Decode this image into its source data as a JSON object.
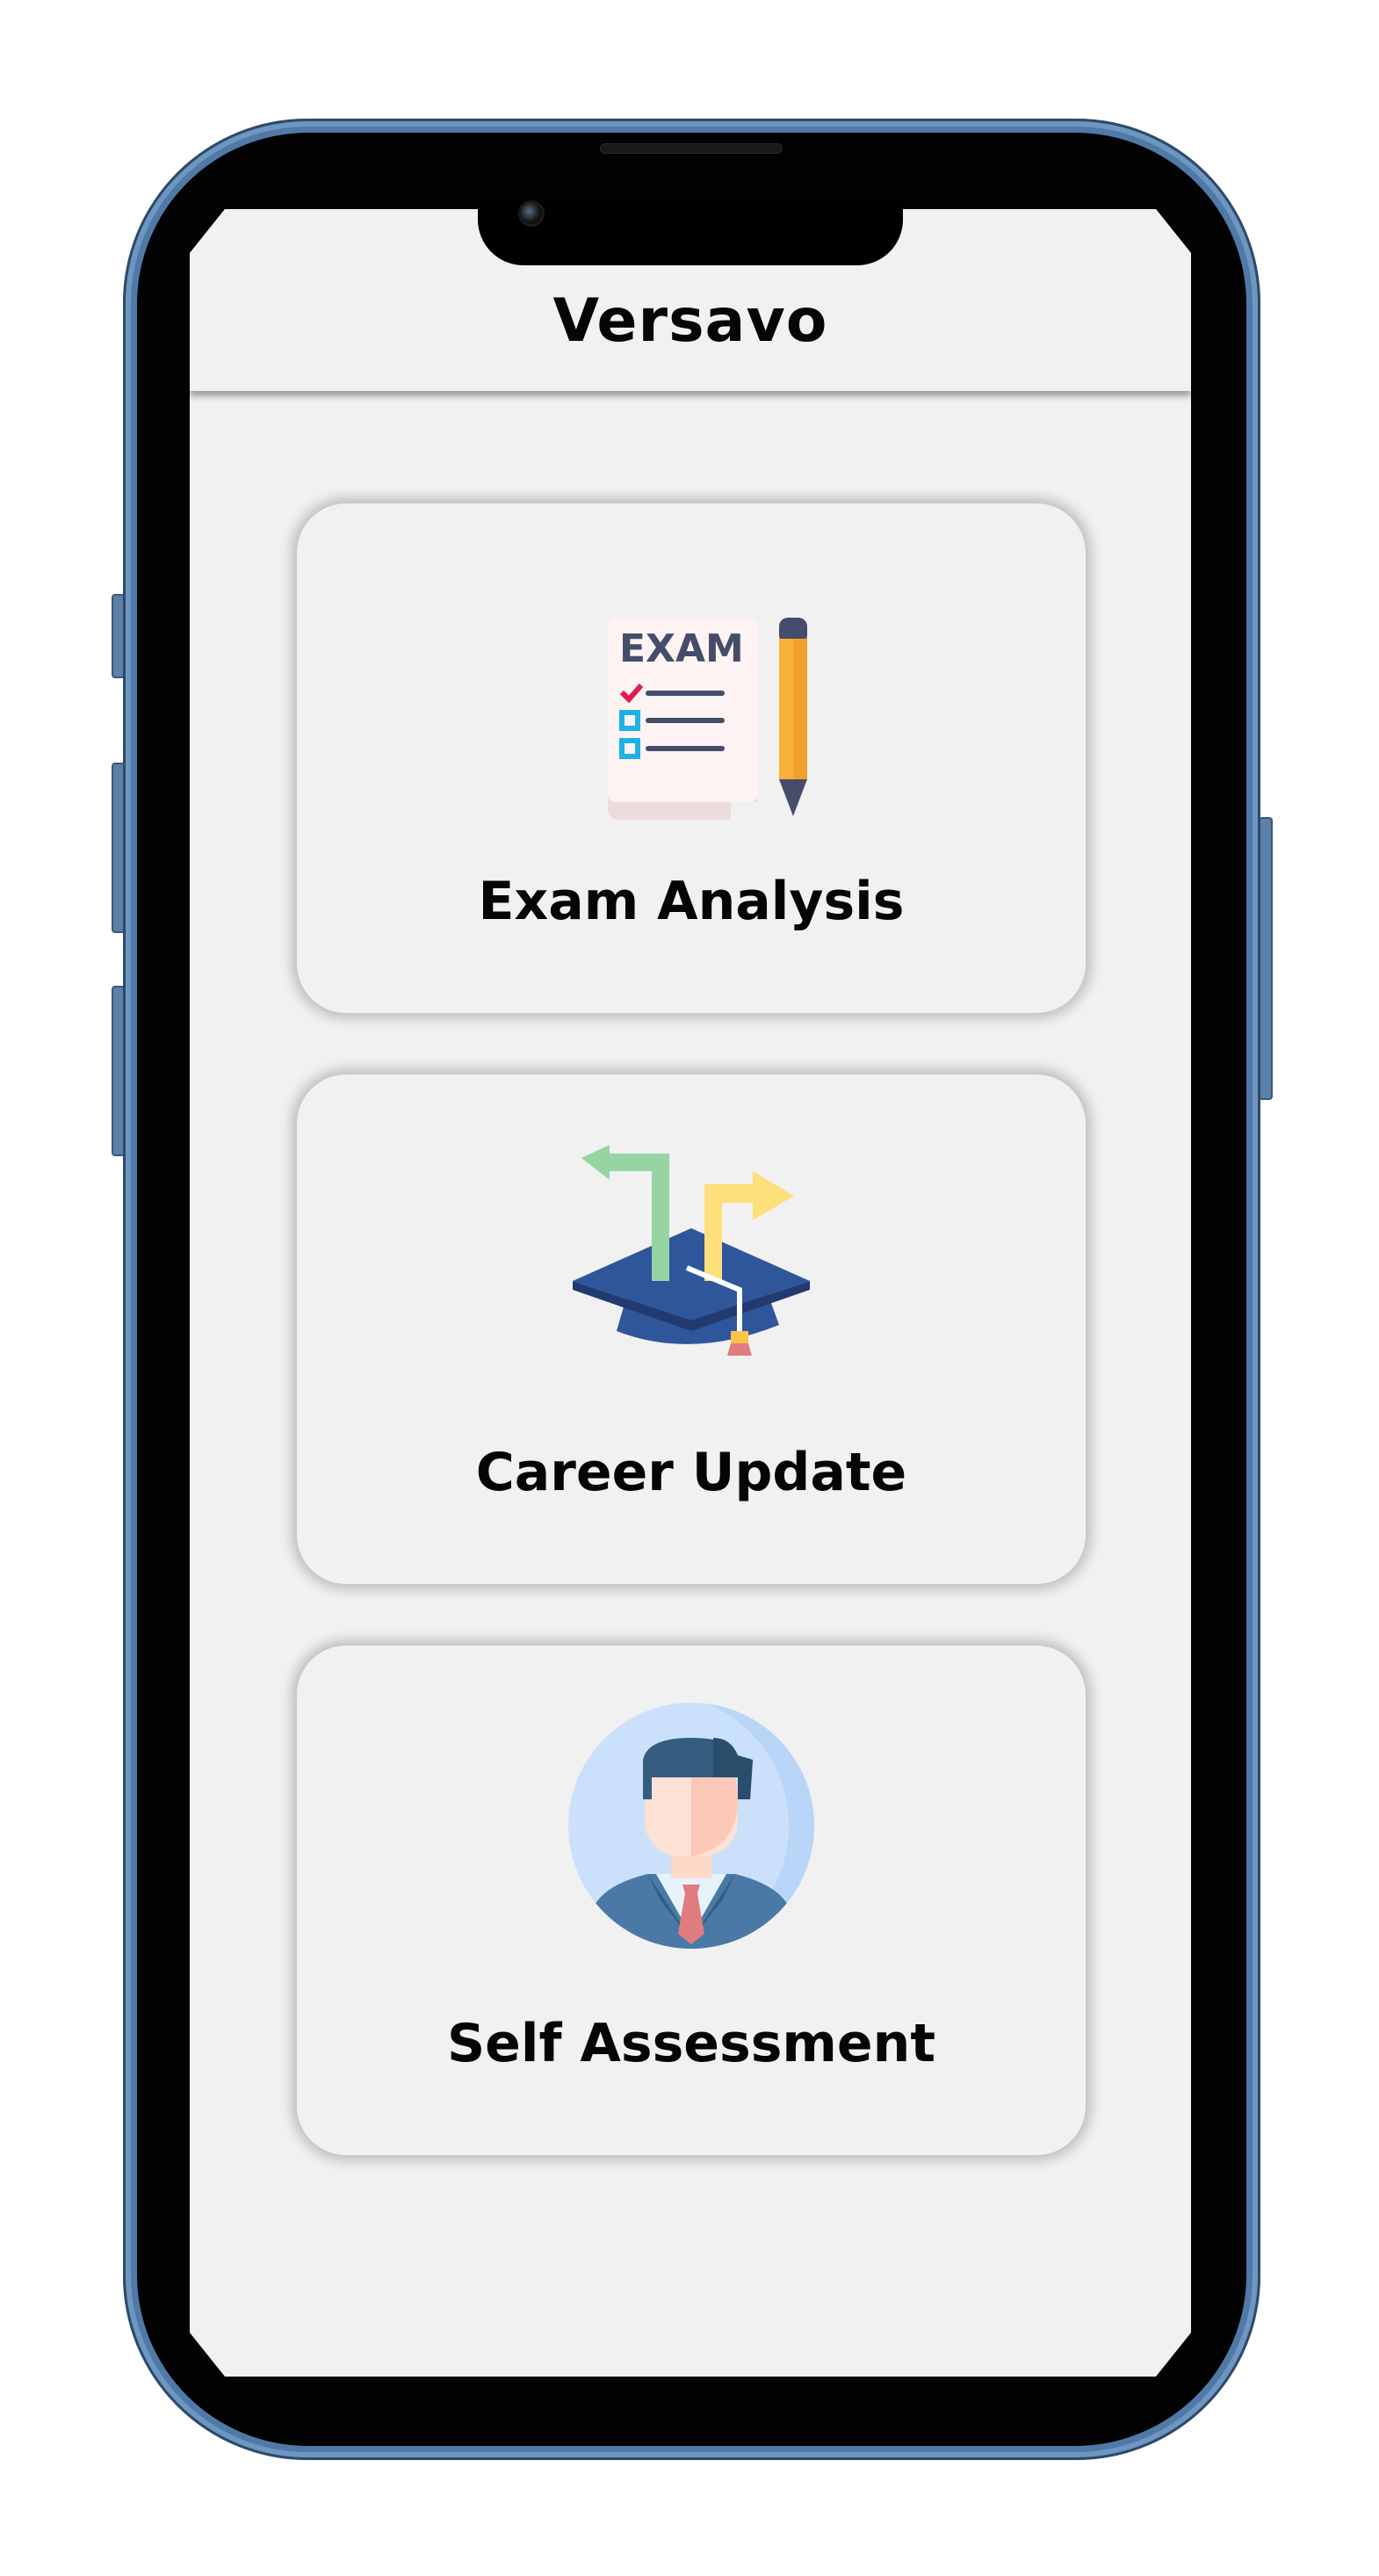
{
  "app": {
    "title": "Versavo"
  },
  "cards": [
    {
      "label": "Exam Analysis",
      "icon": "exam-checklist-pencil-icon",
      "icon_text": "EXAM"
    },
    {
      "label": "Career Update",
      "icon": "graduation-cap-arrows-icon"
    },
    {
      "label": "Self Assessment",
      "icon": "businessman-avatar-icon"
    }
  ],
  "colors": {
    "screen_bg": "#f1f1f1",
    "text": "#050505",
    "frame": "#4f7aa8"
  }
}
